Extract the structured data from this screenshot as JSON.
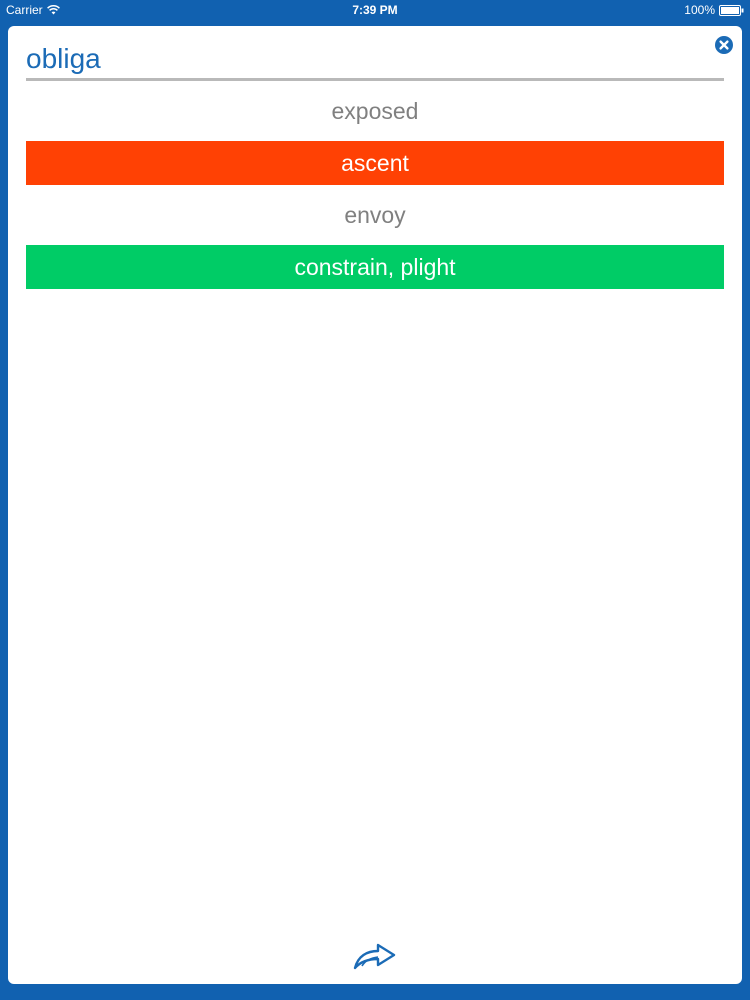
{
  "status_bar": {
    "carrier": "Carrier",
    "time": "7:39 PM",
    "battery": "100%",
    "icons": [
      "wifi-icon",
      "battery-icon"
    ]
  },
  "quiz": {
    "word": "obliga",
    "options": [
      {
        "label": "exposed",
        "state": "neutral"
      },
      {
        "label": "ascent",
        "state": "wrong"
      },
      {
        "label": "envoy",
        "state": "neutral"
      },
      {
        "label": "constrain, plight",
        "state": "correct"
      }
    ]
  },
  "icons": {
    "close": "close-icon",
    "next": "forward-arrow-icon"
  },
  "colors": {
    "frame": "#1161b0",
    "accent": "#1b6bb6",
    "wrong": "#ff4104",
    "correct": "#00cc66",
    "neutral_text": "#808080"
  }
}
